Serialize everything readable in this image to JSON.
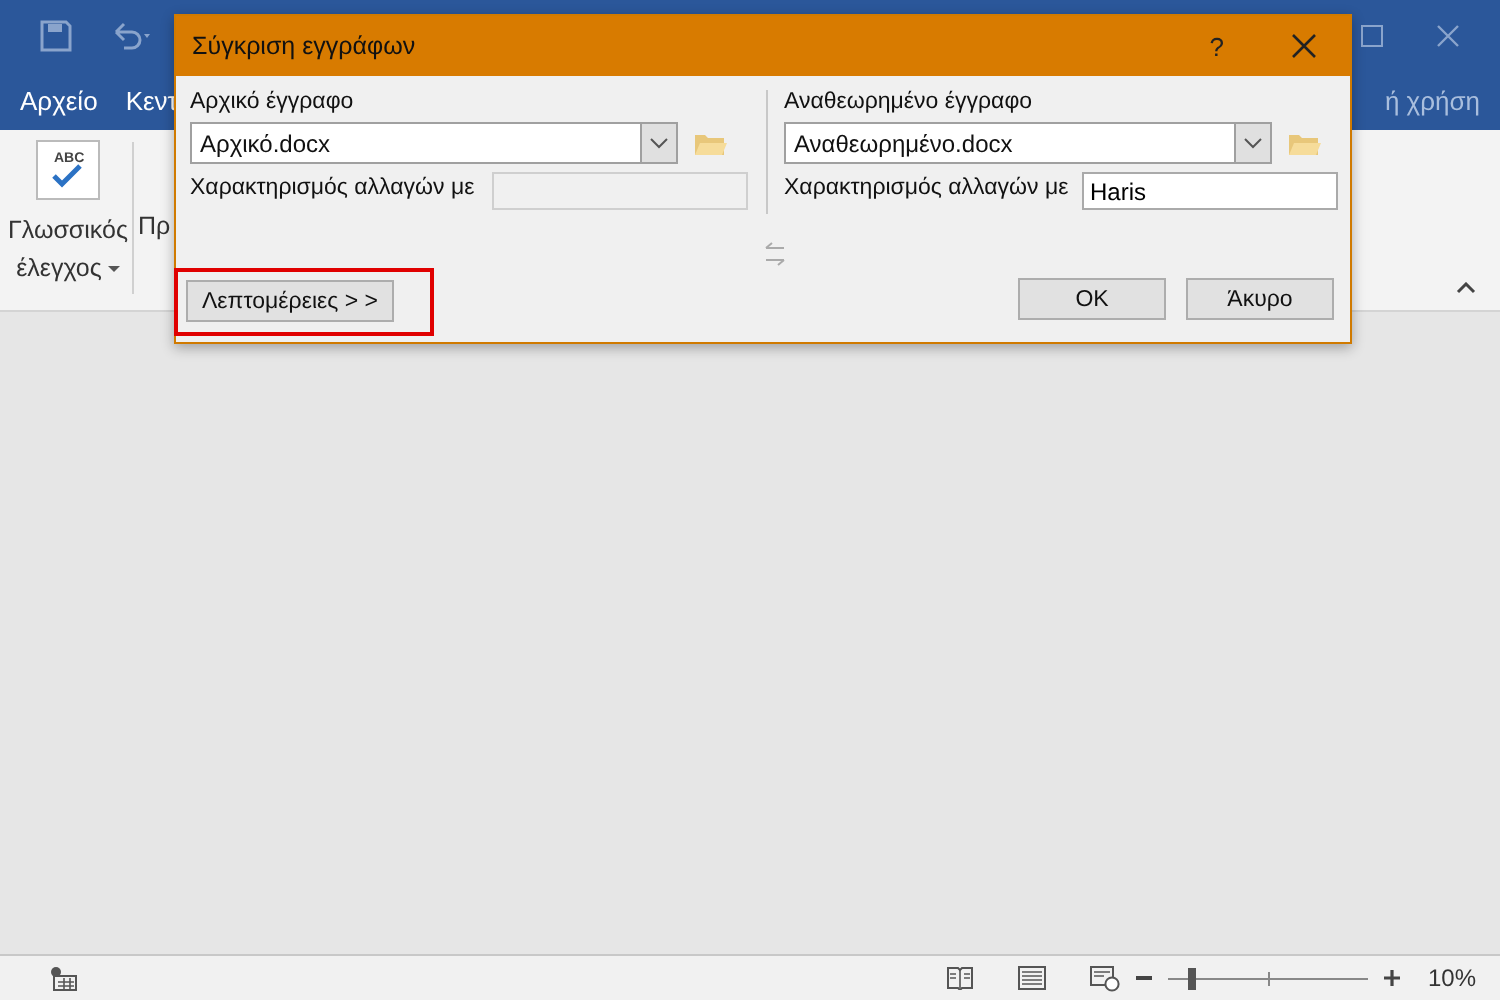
{
  "app": {
    "tabs": [
      {
        "label": "Αρχείο"
      },
      {
        "label": "Κεντ"
      }
    ],
    "tab_right": "ή χρήση",
    "ribbon": {
      "buttons": [
        {
          "label": "Γλωσσικός έλεγχος",
          "icon_text": "ABC",
          "kind": "big"
        },
        {
          "label": "Πρ",
          "kind": "big"
        }
      ]
    },
    "status_bar": {
      "zoom": "10%",
      "zoom_level": {
        "level": 0.1
      }
    }
  },
  "dialog": {
    "title": "Σύγκριση εγγράφων",
    "help": "?",
    "panels": [
      {
        "label": "Αρχικό έγγραφο",
        "file": "Αρχικό.docx",
        "changes_label": "Χαρακτηρισμός αλλαγών με",
        "disabled": true
      },
      {
        "label": "Αναθεωρημένο έγγραφο",
        "file": "Αναθεωρημένο.docx",
        "changes_label": "Χαρακτηρισμός αλλαγών με",
        "changes_value": "Haris",
        "disabled": false
      }
    ],
    "buttons": [
      {
        "label": "Λεπτομέρειες > >",
        "kind": "more",
        "highlighted": true
      },
      {
        "label": "OK",
        "kind": "ok",
        "highlighted": false
      },
      {
        "label": "Άκυρο",
        "kind": "cancel",
        "highlighted": false
      }
    ]
  }
}
